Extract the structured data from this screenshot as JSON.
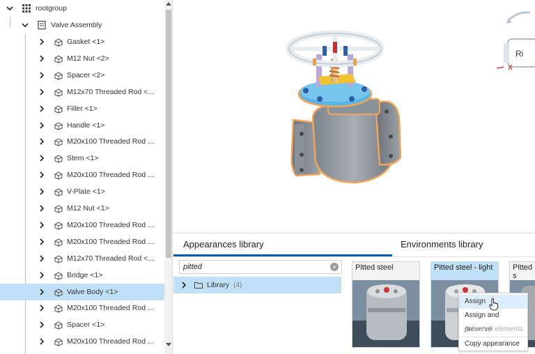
{
  "tree": {
    "root_label": "rootgroup",
    "assembly_label": "Valve Assembly",
    "items": [
      "Gasket <1>",
      "M12 Nut <2>",
      "Spacer <2>",
      "M12x70 Threaded Rod <...",
      "Filler <1>",
      "Handle <1>",
      "M20x100 Threaded Rod ...",
      "Stem <1>",
      "M20x100 Threaded Rod ...",
      "V-Plate <1>",
      "M12 Nut <1>",
      "M20x100 Threaded Rod ...",
      "M20x100 Threaded Rod ...",
      "M12x70 Threaded Rod <...",
      "Bridge <1>",
      "Valve Body <1>",
      "M20x100 Threaded Rod ...",
      "Spacer <1>",
      "M20x100 Threaded Rod ..."
    ],
    "selected_label": "Valve Body <1>"
  },
  "viewcube": {
    "face_label": "Ri",
    "axis_label": "X"
  },
  "library": {
    "tab_appearances": "Appearances library",
    "tab_environments": "Environments library",
    "search_value": "pitted",
    "clear_glyph": "×",
    "folder_label": "Library",
    "folder_count": "(4)",
    "swatches": [
      "Pitted steel",
      "Pitted steel - light",
      "Pitted s medium"
    ]
  },
  "context_menu": {
    "assign": "Assign",
    "assign_preserve": "Assign and preserve",
    "select_all": "Select all elements",
    "copy": "Copy appearance"
  },
  "colors": {
    "selection": "#bfe0f6",
    "accent": "#0a5cad",
    "valve_body": "#8d959d",
    "outline": "#f0a55a",
    "flange_blue": "#5ab4e4",
    "bolt_purple": "#b9a9d8",
    "handwheel": "#e6ecef"
  }
}
